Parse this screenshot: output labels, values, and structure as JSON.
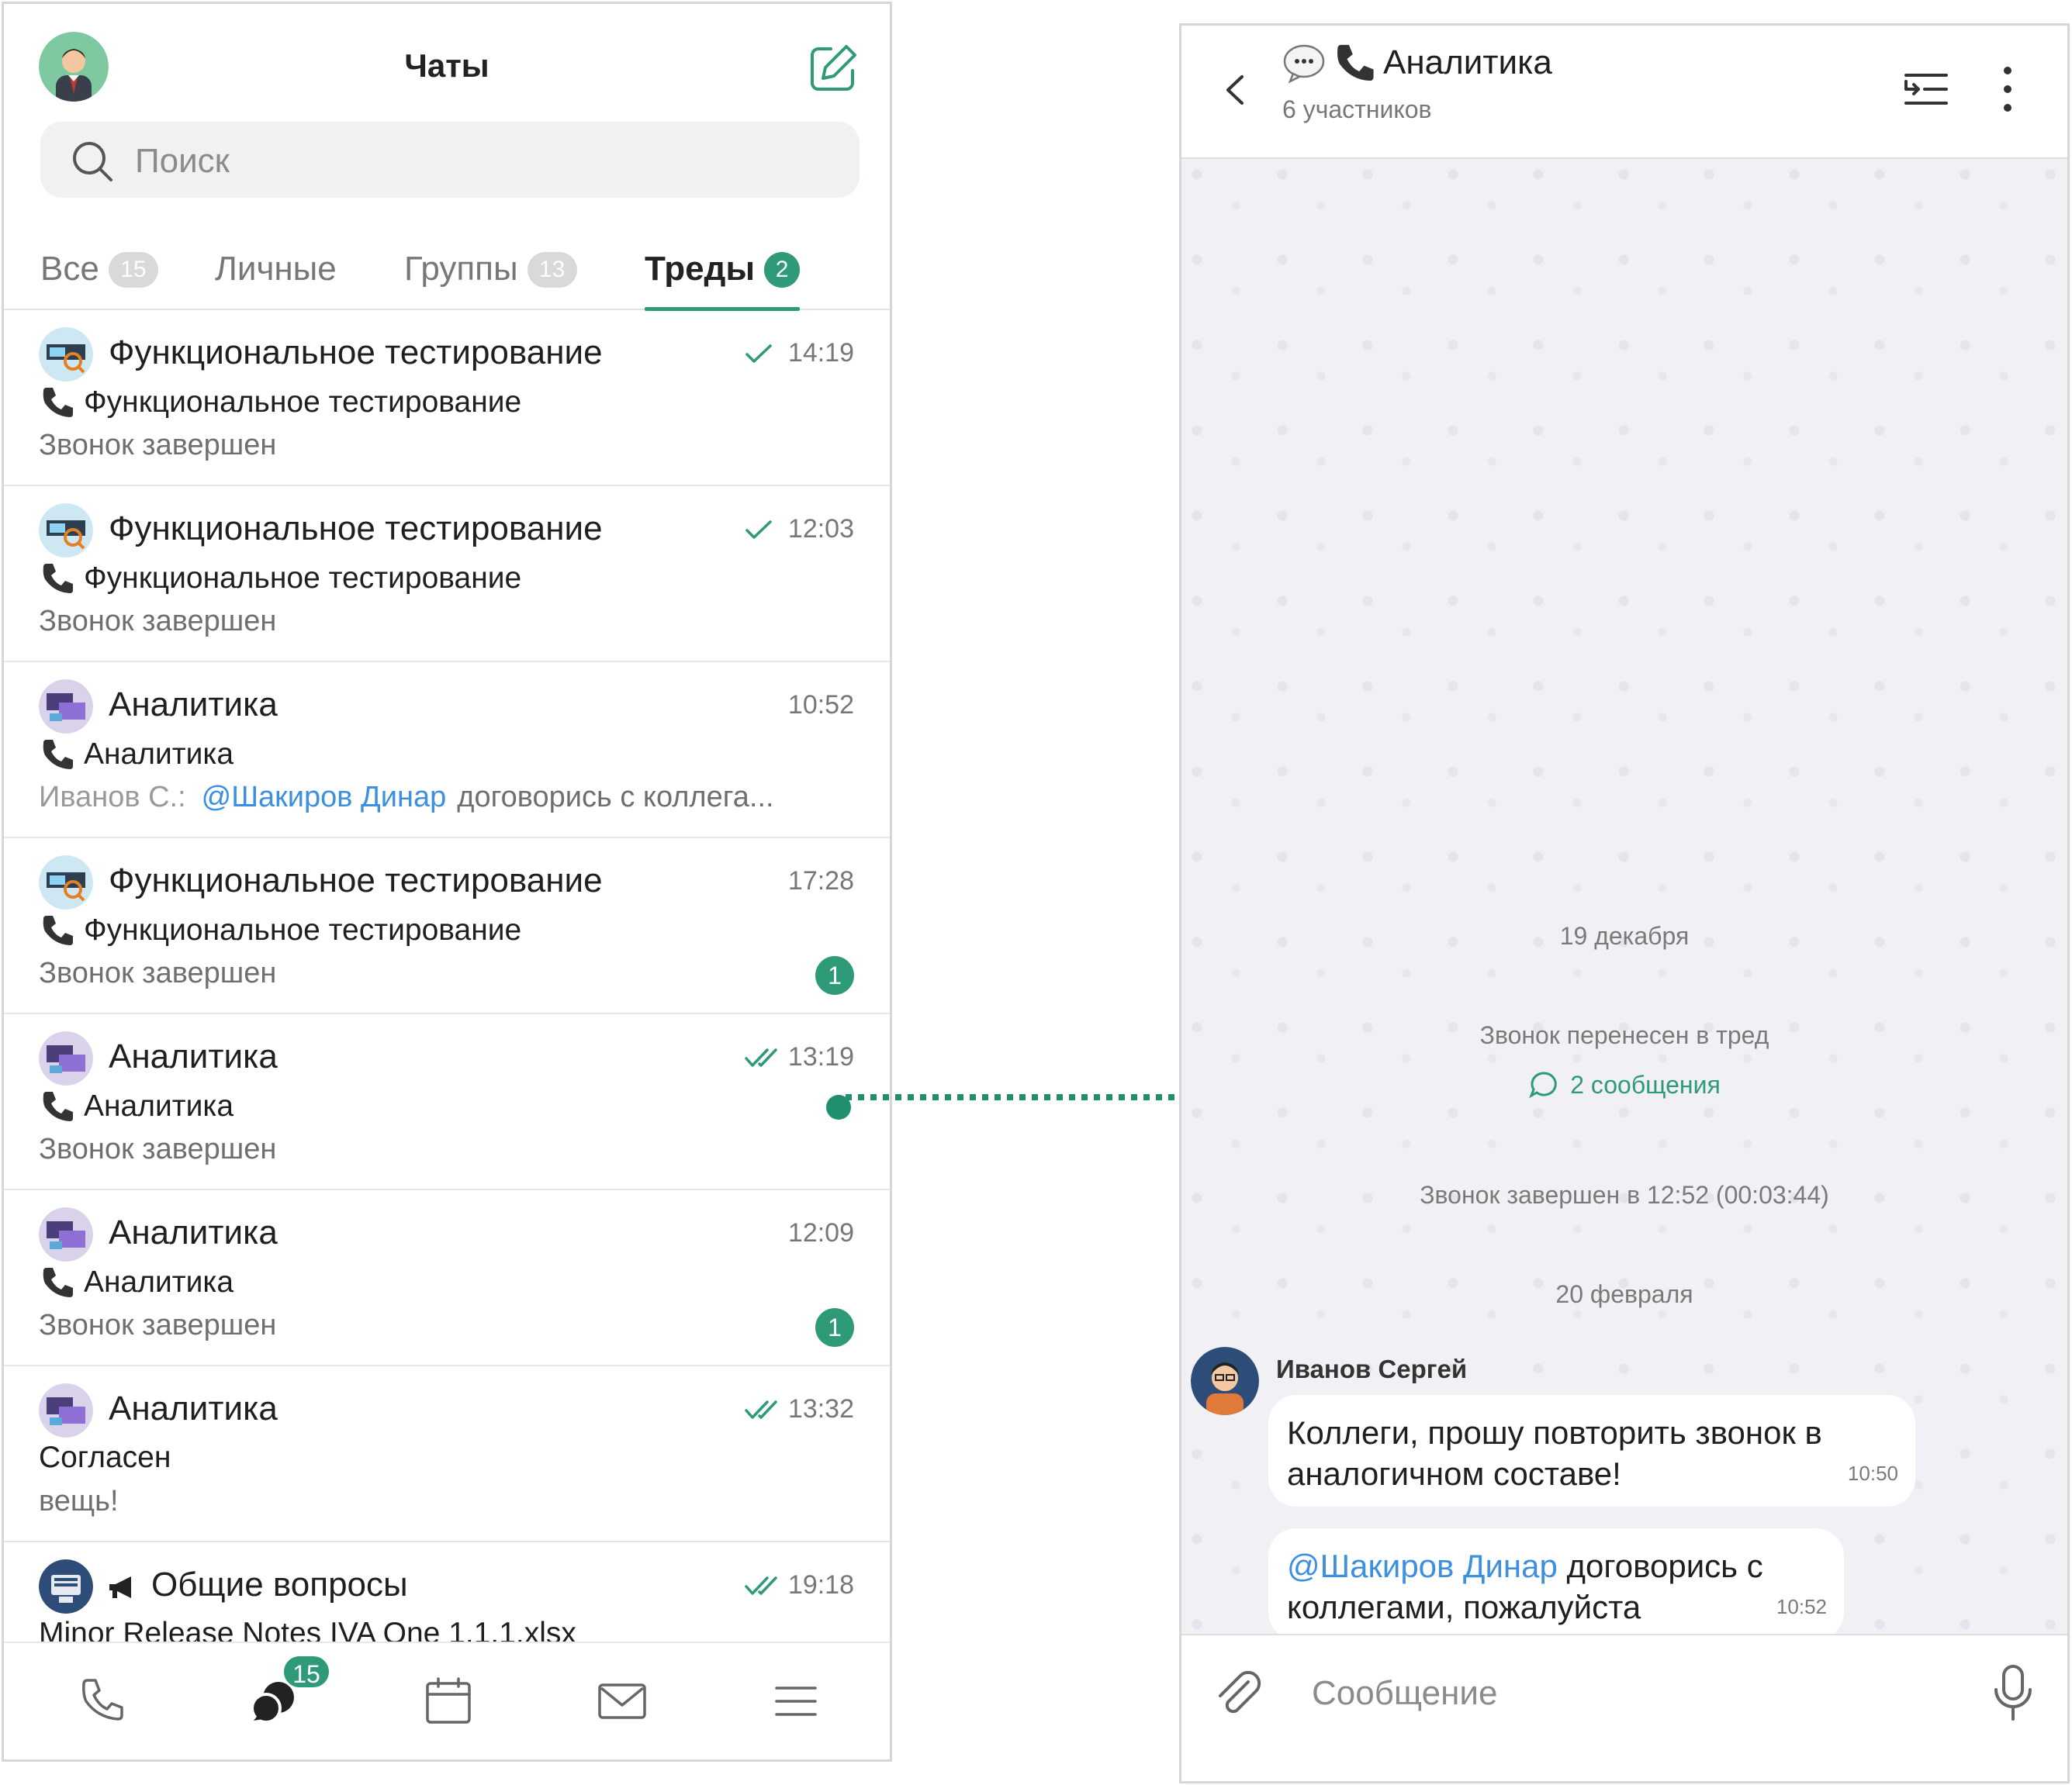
{
  "left": {
    "title": "Чаты",
    "search": {
      "placeholder": "Поиск"
    },
    "tabs": [
      {
        "label": "Все",
        "count": "15"
      },
      {
        "label": "Личные",
        "count": ""
      },
      {
        "label": "Группы",
        "count": "13"
      },
      {
        "label": "Треды",
        "count": "2",
        "active": true
      }
    ],
    "chats": [
      {
        "title": "Функциональное тестирование",
        "time": "14:19",
        "status": "sent",
        "sub": "Функциональное тестирование",
        "preview": "Звонок завершен"
      },
      {
        "title": "Функциональное тестирование",
        "time": "12:03",
        "status": "sent",
        "sub": "Функциональное тестирование",
        "preview": "Звонок завершен"
      },
      {
        "title": "Аналитика",
        "time": "10:52",
        "sub": "Аналитика",
        "preview_sender": "Иванов С.:",
        "preview_mention": "@Шакиров Динар",
        "preview": "договорись с коллега..."
      },
      {
        "title": "Функциональное тестирование",
        "time": "17:28",
        "sub": "Функциональное тестирование",
        "preview": "Звонок завершен",
        "unread": "1"
      },
      {
        "title": "Аналитика",
        "time": "13:19",
        "status": "read",
        "sub": "Аналитика",
        "preview": "Звонок завершен"
      },
      {
        "title": "Аналитика",
        "time": "12:09",
        "sub": "Аналитика",
        "preview": "Звонок завершен",
        "unread": "1"
      },
      {
        "title": "Аналитика",
        "time": "13:32",
        "status": "read",
        "sub": "Согласен",
        "preview": "вещь!"
      },
      {
        "title": "Общие вопросы",
        "time": "19:18",
        "status": "read",
        "sub": "Minor Release Notes IVA One 1.1.1.xlsx",
        "preview": ""
      }
    ],
    "nav": {
      "chats_badge": "15",
      "icons": [
        "phone-icon",
        "chats-icon",
        "calendar-icon",
        "mail-icon",
        "menu-icon"
      ]
    }
  },
  "right": {
    "title": "Аналитика",
    "subtitle": "6 участников",
    "system": {
      "date1": "19 декабря",
      "moved": "Звонок перенесен в тред",
      "thread_link": "2 сообщения",
      "ended": "Звонок завершен в 12:52 (00:03:44)",
      "date2": "20 февраля"
    },
    "message": {
      "author": "Иванов Сергей",
      "bubble1": {
        "line1": "Коллеги, прошу повторить звонок в",
        "line2": "аналогичном составе!",
        "time": "10:50"
      },
      "bubble2": {
        "mention": "@Шакиров Динар",
        "line1_rest": " договорись с",
        "line2": "коллегами, пожалуйста",
        "time": "10:52"
      }
    },
    "composer": {
      "placeholder": "Сообщение"
    }
  },
  "colors": {
    "accent": "#2e9a78",
    "mention": "#3d8fe0",
    "chat_bg": "#f1f0f4"
  }
}
